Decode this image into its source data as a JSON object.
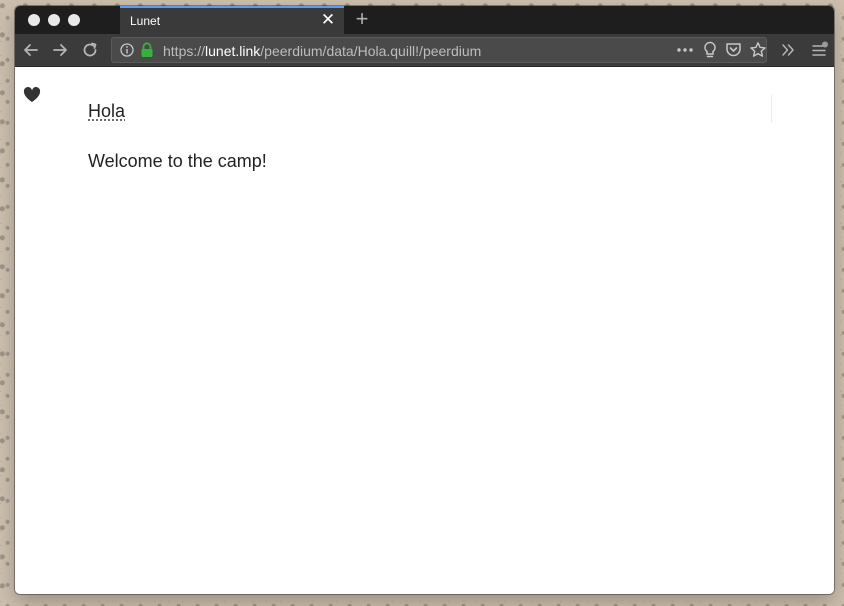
{
  "browser": {
    "tab": {
      "title": "Lunet"
    },
    "url": {
      "scheme": "https://",
      "domain": "lunet.link",
      "path": "/peerdium/data/Hola.quill!/peerdium"
    },
    "colors": {
      "tab_accent": "#5b9bf0",
      "lock": "#36b23c"
    }
  },
  "page": {
    "title": "Hola",
    "body": "Welcome to the camp!"
  }
}
